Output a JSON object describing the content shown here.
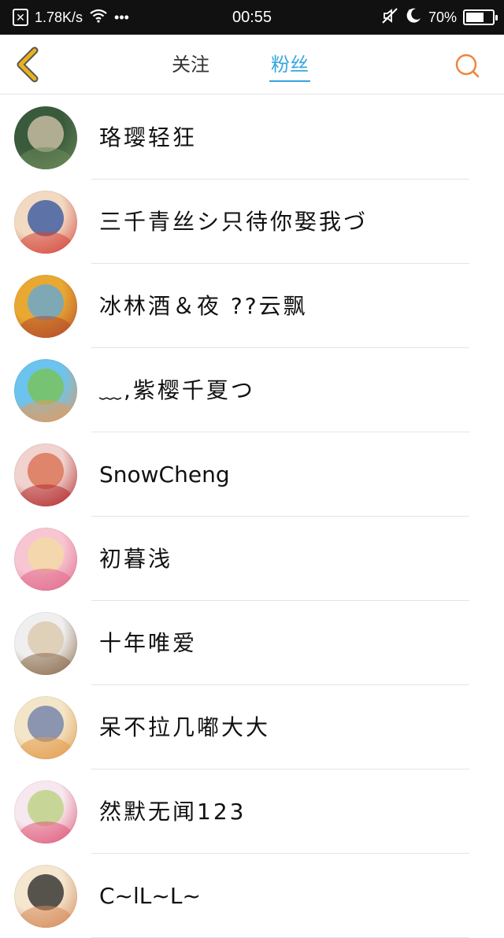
{
  "status_bar": {
    "network_speed": "1.78K/s",
    "dots": "•••",
    "time": "00:55",
    "battery": "70%",
    "battery_level": 0.7
  },
  "header": {
    "tabs": [
      {
        "label": "关注",
        "active": false
      },
      {
        "label": "粉丝",
        "active": true
      }
    ],
    "accent_color": "#35a6e0",
    "back_icon_color": "#e8b21e",
    "search_icon_color": "#f0833a"
  },
  "fans": [
    {
      "name": "珞璎轻狂",
      "avatar_colors": [
        "#3a5a3c",
        "#d8c9b0",
        "#6b8a5a"
      ]
    },
    {
      "name": "三千青丝シ只待你娶我づ",
      "avatar_colors": [
        "#f2d9c2",
        "#2b4f9c",
        "#d4463b"
      ]
    },
    {
      "name": "冰林酒＆夜 ??云飘",
      "avatar_colors": [
        "#e9a832",
        "#5aa9e0",
        "#b44b2a"
      ]
    },
    {
      "name": "﹏,紫樱千夏つ",
      "avatar_colors": [
        "#6cc3ee",
        "#7bc34b",
        "#e89a5a"
      ]
    },
    {
      "name": "SnowCheng",
      "avatar_colors": [
        "#f0d2cf",
        "#d96b4a",
        "#b32b2b"
      ]
    },
    {
      "name": "初暮浅",
      "avatar_colors": [
        "#f7c6d2",
        "#f3dca0",
        "#e26a8c"
      ]
    },
    {
      "name": "十年唯爱",
      "avatar_colors": [
        "#efefef",
        "#d9c5a8",
        "#8a6a48"
      ]
    },
    {
      "name": "呆不拉几嘟大大",
      "avatar_colors": [
        "#f3e6c8",
        "#6a7aa8",
        "#e39a4a"
      ]
    },
    {
      "name": "然默无闻123",
      "avatar_colors": [
        "#f6e8ee",
        "#b7d07a",
        "#e05a7a"
      ]
    },
    {
      "name": "C~lL~L~",
      "avatar_colors": [
        "#f4e6cf",
        "#222222",
        "#d68a5a"
      ]
    }
  ]
}
